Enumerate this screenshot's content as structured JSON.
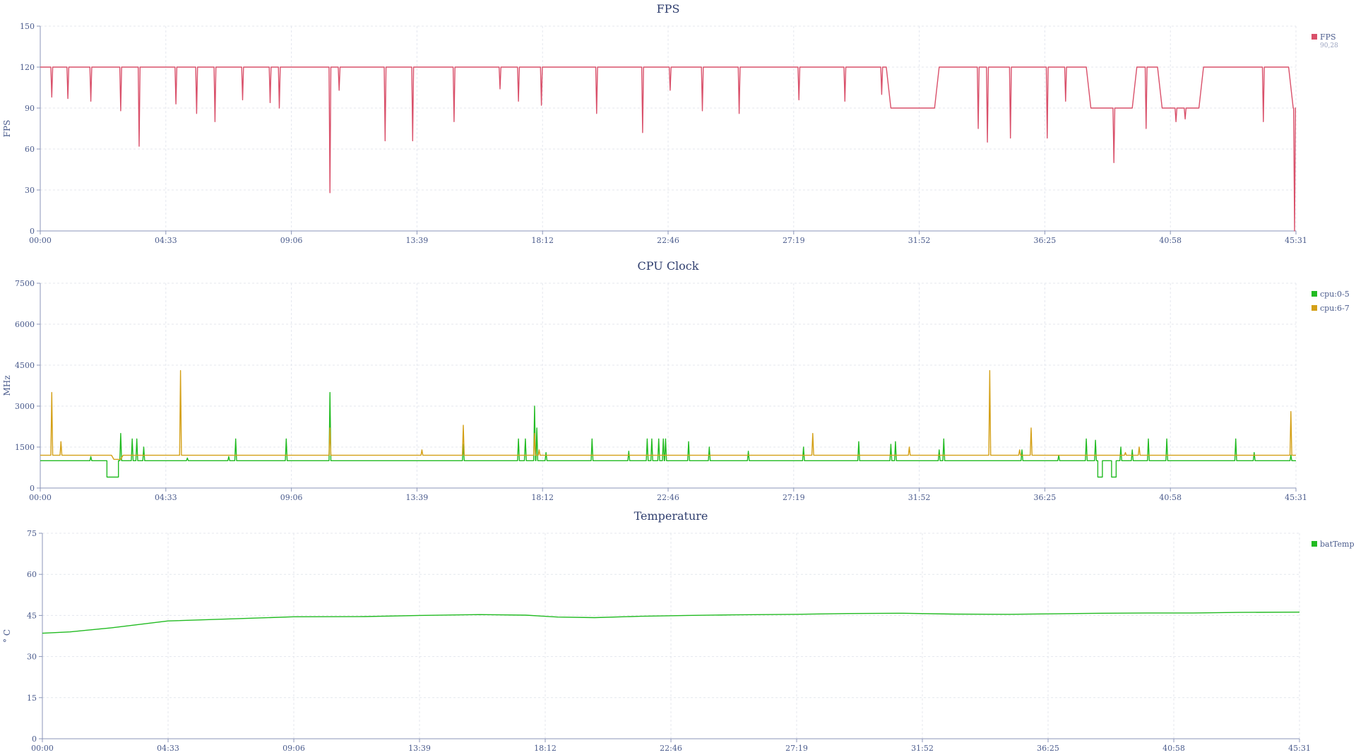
{
  "chart_data": [
    {
      "type": "line",
      "title": "FPS",
      "ylabel": "FPS",
      "xlabel": "",
      "ylim": [
        0,
        150
      ],
      "yticks": [
        0,
        30,
        60,
        90,
        120,
        150
      ],
      "xticks": [
        "00:00",
        "04:33",
        "09:06",
        "13:39",
        "18:12",
        "22:46",
        "27:19",
        "31:52",
        "36:25",
        "40:58",
        "45:31"
      ],
      "grid": true,
      "legend_position": "top-right",
      "series": [
        {
          "name": "FPS",
          "legend_sub": "90,28",
          "color": "#d9506a",
          "baseline": [
            [
              0,
              120
            ],
            [
              1840,
              120
            ],
            [
              1850,
              90
            ],
            [
              1945,
              90
            ],
            [
              1955,
              120
            ],
            [
              2275,
              120
            ],
            [
              2285,
              90
            ],
            [
              2375,
              90
            ],
            [
              2385,
              120
            ],
            [
              2430,
              120
            ],
            [
              2440,
              90
            ],
            [
              2520,
              90
            ],
            [
              2530,
              120
            ],
            [
              2715,
              120
            ],
            [
              2725,
              90
            ],
            [
              2731,
              90
            ]
          ],
          "spikes": [
            [
              25,
              98
            ],
            [
              60,
              97
            ],
            [
              110,
              95
            ],
            [
              175,
              88
            ],
            [
              215,
              62
            ],
            [
              295,
              93
            ],
            [
              340,
              86
            ],
            [
              380,
              80
            ],
            [
              440,
              96
            ],
            [
              500,
              94
            ],
            [
              520,
              90
            ],
            [
              630,
              28
            ],
            [
              650,
              103
            ],
            [
              750,
              66
            ],
            [
              810,
              66
            ],
            [
              900,
              80
            ],
            [
              1000,
              104
            ],
            [
              1040,
              95
            ],
            [
              1090,
              92
            ],
            [
              1210,
              86
            ],
            [
              1310,
              72
            ],
            [
              1370,
              103
            ],
            [
              1440,
              88
            ],
            [
              1520,
              86
            ],
            [
              1650,
              96
            ],
            [
              1750,
              95
            ],
            [
              1830,
              100
            ],
            [
              2040,
              75
            ],
            [
              2060,
              65
            ],
            [
              2110,
              68
            ],
            [
              2190,
              68
            ],
            [
              2230,
              95
            ],
            [
              2320,
              90
            ],
            [
              2335,
              50
            ],
            [
              2405,
              75
            ],
            [
              2470,
              80
            ],
            [
              2490,
              82
            ],
            [
              2660,
              80
            ],
            [
              2728,
              0
            ]
          ]
        }
      ]
    },
    {
      "type": "line",
      "title": "CPU Clock",
      "ylabel": "MHz",
      "xlabel": "",
      "ylim": [
        0,
        7500
      ],
      "yticks": [
        0,
        1500,
        3000,
        4500,
        6000,
        7500
      ],
      "xticks": [
        "00:00",
        "04:33",
        "09:06",
        "13:39",
        "18:12",
        "22:46",
        "27:19",
        "31:52",
        "36:25",
        "40:58",
        "45:31"
      ],
      "grid": true,
      "legend_position": "top-right",
      "series": [
        {
          "name": "cpu:0-5",
          "color": "#22bb22",
          "baseline": [
            [
              0,
              1000
            ],
            [
              145,
              1000
            ],
            [
              145,
              400
            ],
            [
              170,
              400
            ],
            [
              170,
              1000
            ],
            [
              2300,
              1000
            ],
            [
              2300,
              400
            ],
            [
              2310,
              400
            ],
            [
              2310,
              1000
            ],
            [
              2330,
              1000
            ],
            [
              2330,
              400
            ],
            [
              2340,
              400
            ],
            [
              2340,
              1000
            ],
            [
              2731,
              1000
            ]
          ],
          "spikes": [
            [
              110,
              1150
            ],
            [
              175,
              2000
            ],
            [
              200,
              1800
            ],
            [
              210,
              1800
            ],
            [
              225,
              1500
            ],
            [
              320,
              1100
            ],
            [
              410,
              1150
            ],
            [
              425,
              1800
            ],
            [
              535,
              1800
            ],
            [
              630,
              3500
            ],
            [
              920,
              1600
            ],
            [
              1040,
              1800
            ],
            [
              1055,
              1800
            ],
            [
              1075,
              3000
            ],
            [
              1080,
              2200
            ],
            [
              1100,
              1300
            ],
            [
              1200,
              1800
            ],
            [
              1280,
              1350
            ],
            [
              1320,
              1800
            ],
            [
              1330,
              1800
            ],
            [
              1345,
              1800
            ],
            [
              1355,
              1800
            ],
            [
              1360,
              1800
            ],
            [
              1410,
              1700
            ],
            [
              1455,
              1500
            ],
            [
              1540,
              1350
            ],
            [
              1660,
              1500
            ],
            [
              1780,
              1700
            ],
            [
              1850,
              1600
            ],
            [
              1860,
              1700
            ],
            [
              1955,
              1400
            ],
            [
              1965,
              1800
            ],
            [
              2135,
              1400
            ],
            [
              2215,
              1200
            ],
            [
              2275,
              1800
            ],
            [
              2295,
              1750
            ],
            [
              2350,
              1500
            ],
            [
              2375,
              1400
            ],
            [
              2410,
              1800
            ],
            [
              2450,
              1800
            ],
            [
              2600,
              1800
            ],
            [
              2640,
              1300
            ],
            [
              2720,
              1200
            ]
          ]
        },
        {
          "name": "cpu:6-7",
          "color": "#d4a017",
          "baseline": [
            [
              0,
              1200
            ],
            [
              155,
              1200
            ],
            [
              160,
              1050
            ],
            [
              175,
              1050
            ],
            [
              180,
              1200
            ],
            [
              2731,
              1200
            ]
          ],
          "spikes": [
            [
              25,
              3500
            ],
            [
              45,
              1700
            ],
            [
              305,
              4300
            ],
            [
              630,
              2200
            ],
            [
              830,
              1400
            ],
            [
              920,
              2300
            ],
            [
              1075,
              2000
            ],
            [
              1085,
              1400
            ],
            [
              1680,
              2000
            ],
            [
              1890,
              1500
            ],
            [
              2065,
              4300
            ],
            [
              2130,
              1400
            ],
            [
              2155,
              2200
            ],
            [
              2360,
              1300
            ],
            [
              2390,
              1500
            ],
            [
              2720,
              2800
            ]
          ]
        }
      ]
    },
    {
      "type": "line",
      "title": "Temperature",
      "ylabel": "° C",
      "xlabel": "",
      "ylim": [
        0,
        75
      ],
      "yticks": [
        0,
        15,
        30,
        45,
        60,
        75
      ],
      "xticks": [
        "00:00",
        "04:33",
        "09:06",
        "13:39",
        "18:12",
        "22:46",
        "27:19",
        "31:52",
        "36:25",
        "40:58",
        "45:31"
      ],
      "grid": true,
      "legend_position": "top-right",
      "series": [
        {
          "name": "batTemp",
          "color": "#22bb22",
          "points": [
            [
              0,
              38.5
            ],
            [
              60,
              39
            ],
            [
              150,
              40.5
            ],
            [
              273,
              43
            ],
            [
              420,
              43.8
            ],
            [
              546,
              44.5
            ],
            [
              700,
              44.6
            ],
            [
              819,
              45
            ],
            [
              950,
              45.3
            ],
            [
              1050,
              45.1
            ],
            [
              1120,
              44.4
            ],
            [
              1200,
              44.2
            ],
            [
              1300,
              44.7
            ],
            [
              1400,
              45
            ],
            [
              1500,
              45.2
            ],
            [
              1638,
              45.4
            ],
            [
              1750,
              45.7
            ],
            [
              1870,
              45.8
            ],
            [
              1980,
              45.5
            ],
            [
              2100,
              45.4
            ],
            [
              2200,
              45.6
            ],
            [
              2300,
              45.8
            ],
            [
              2400,
              45.9
            ],
            [
              2500,
              45.9
            ],
            [
              2600,
              46.1
            ],
            [
              2731,
              46.2
            ]
          ]
        }
      ]
    }
  ]
}
